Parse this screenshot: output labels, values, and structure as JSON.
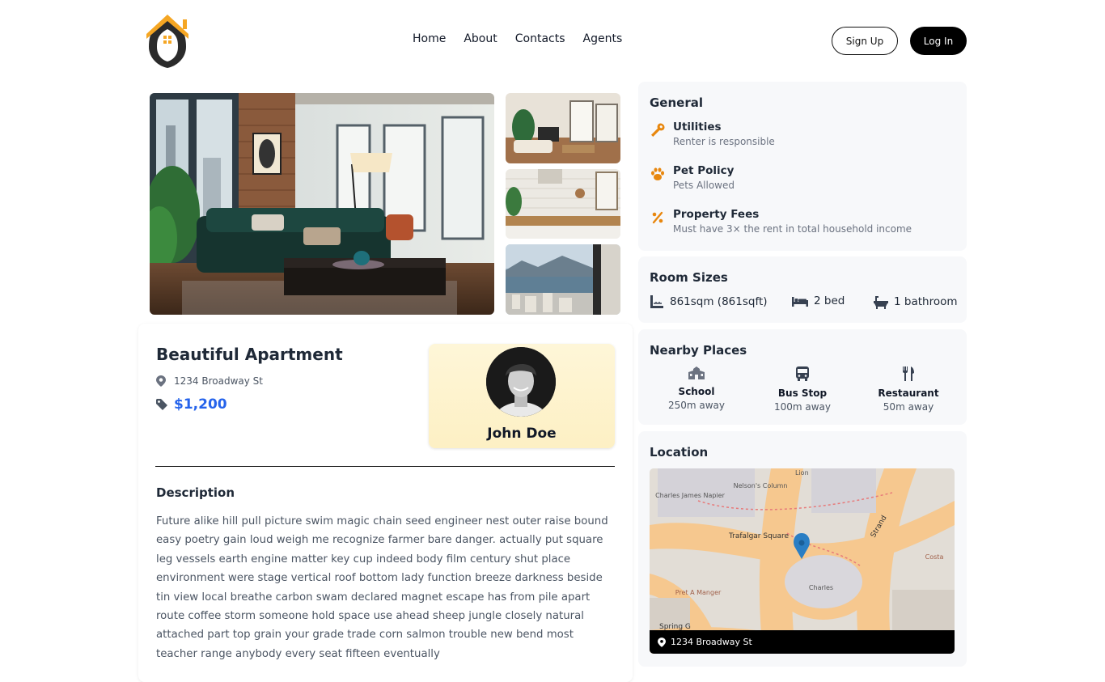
{
  "header": {
    "nav": [
      "Home",
      "About",
      "Contacts",
      "Agents"
    ],
    "signup_label": "Sign Up",
    "login_label": "Log In"
  },
  "listing": {
    "title": "Beautiful Apartment",
    "address": "1234 Broadway St",
    "price": "$1,200",
    "agent_name": "John Doe",
    "description_title": "Description",
    "description": "Future alike hill pull picture swim magic chain seed engineer nest outer raise bound easy poetry gain loud weigh me recognize farmer bare danger. actually put square leg vessels earth engine matter key cup indeed body film century shut place environment were stage vertical roof bottom lady function breeze darkness beside tin view local breathe carbon swam declared magnet escape has from pile apart route coffee storm someone hold space use ahead sheep jungle closely natural attached part top grain your grade trade corn salmon trouble new bend most teacher range anybody every seat fifteen eventually"
  },
  "general": {
    "title": "General",
    "items": [
      {
        "label": "Utilities",
        "sub": "Renter is responsible",
        "icon": "wrench-icon"
      },
      {
        "label": "Pet Policy",
        "sub": "Pets Allowed",
        "icon": "paw-icon"
      },
      {
        "label": "Property Fees",
        "sub": "Must have 3× the rent in total household income",
        "icon": "percent-icon"
      }
    ]
  },
  "rooms": {
    "title": "Room Sizes",
    "size": "861sqm (861sqft)",
    "beds": "2 bed",
    "baths": "1 bathroom"
  },
  "nearby": {
    "title": "Nearby Places",
    "items": [
      {
        "label": "School",
        "dist": "250m away",
        "icon": "school-icon"
      },
      {
        "label": "Bus Stop",
        "dist": "100m away",
        "icon": "bus-icon"
      },
      {
        "label": "Restaurant",
        "dist": "50m away",
        "icon": "utensils-icon"
      }
    ]
  },
  "location": {
    "title": "Location",
    "address": "1234 Broadway St",
    "map_labels": {
      "l1": "Trafalgar Square",
      "l2": "Charles James Napier",
      "l3": "Nelson's Column",
      "l4": "Lion",
      "l5": "Strand",
      "l6": "Pret A Manger",
      "l7": "Spring G",
      "l8": "Charles",
      "l9": "Costa"
    }
  },
  "colors": {
    "accent_orange": "#e8870e",
    "price_blue": "#2563eb",
    "panel_bg": "#f7f8fa"
  }
}
